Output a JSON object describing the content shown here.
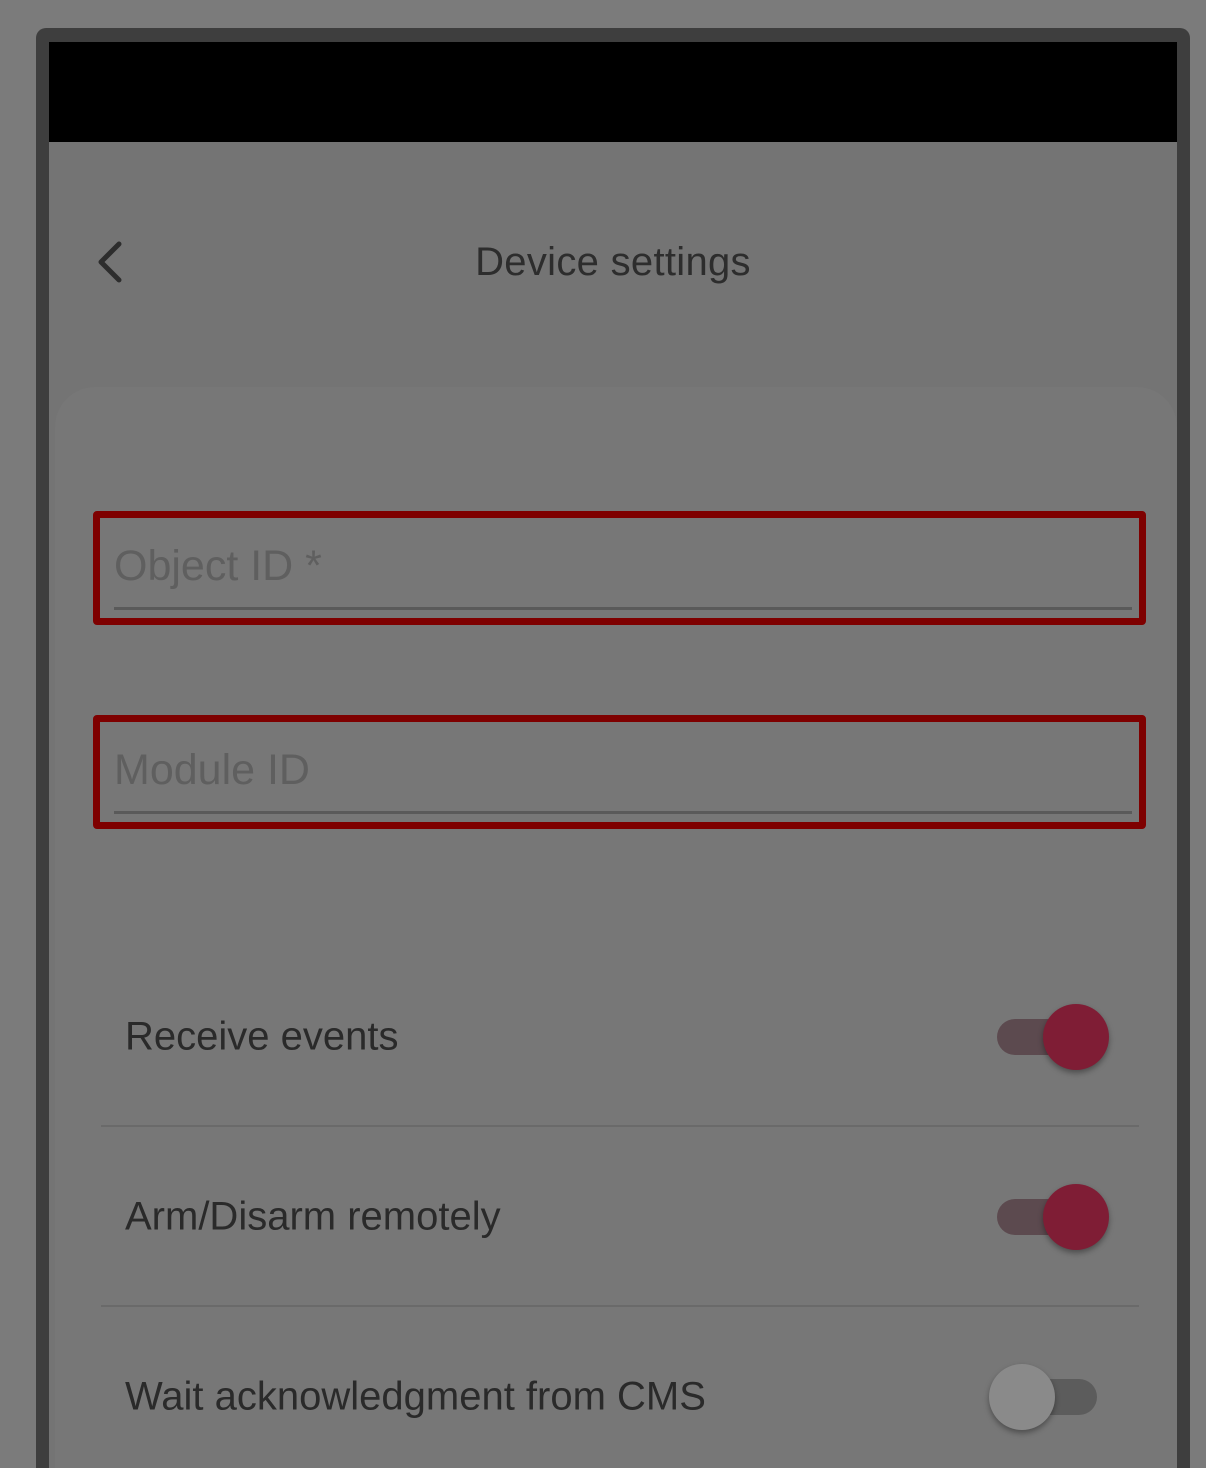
{
  "header": {
    "title": "Device settings",
    "back_icon": "chevron-left-icon"
  },
  "form": {
    "object_id": {
      "placeholder": "Object ID *",
      "value": ""
    },
    "module_id": {
      "placeholder": "Module ID",
      "value": ""
    }
  },
  "settings": [
    {
      "label": "Receive events",
      "enabled": true
    },
    {
      "label": "Arm/Disarm remotely",
      "enabled": true
    },
    {
      "label": "Wait acknowledgment from CMS",
      "enabled": false
    }
  ],
  "colors": {
    "highlight_border": "#7e0000",
    "toggle_on": "#7f1d35",
    "toggle_off": "#8a8a8a",
    "status_bar": "#000000"
  }
}
